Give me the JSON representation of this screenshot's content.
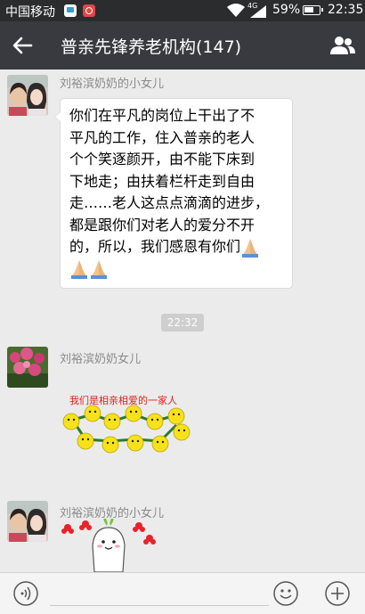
{
  "status_bar": {
    "carrier": "中国移动",
    "network": "4G",
    "battery": "59%",
    "time": "22:35"
  },
  "header": {
    "title": "普亲先锋养老机构(147)"
  },
  "messages": [
    {
      "sender": "刘裕滨奶奶的小女儿",
      "lines": [
        "你们在平凡的岗位上干出了不",
        "平凡的工作，住入普亲的老人",
        "个个笑逐颜开，由不能下床到",
        "下地走；由扶着栏杆走到自由",
        "走……老人这点点滴滴的进步，",
        "都是跟你们对老人的爱分不开",
        "的，所以，我们感恩有你们"
      ]
    },
    {
      "sender": "刘裕滨奶奶女儿",
      "sticker_text": "我们是相亲相爱的一家人"
    },
    {
      "sender": "刘裕滨奶奶的小女儿"
    }
  ],
  "timestamp": "22:32",
  "colors": {
    "status_bar": "#2b2c2e",
    "title_bar": "#393a3f",
    "chat_bg": "#ebebeb",
    "sticker_text": "#d9241b"
  }
}
